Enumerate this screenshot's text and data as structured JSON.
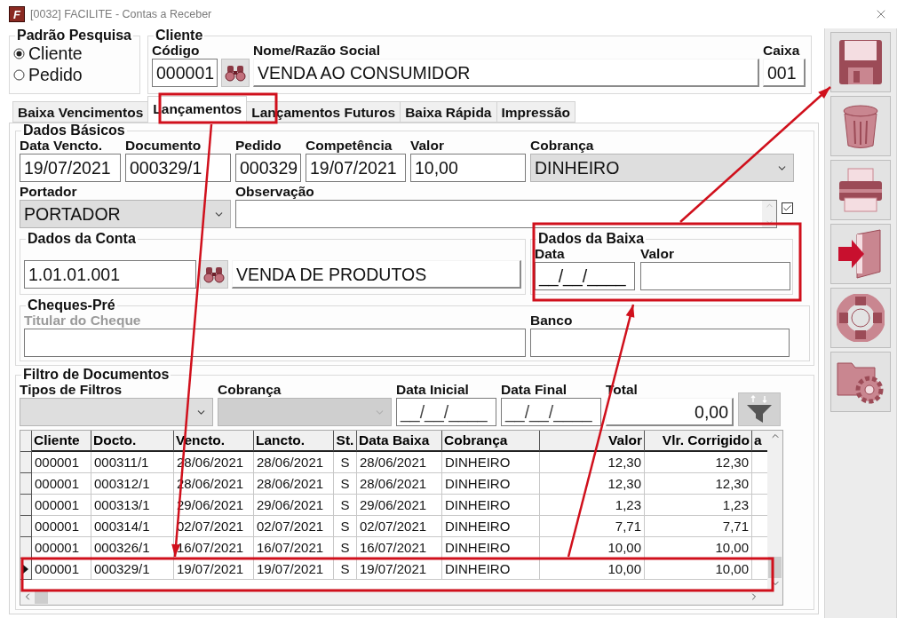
{
  "window": {
    "icon_text": "F",
    "title": "[0032] FACILITE - Contas a Receber"
  },
  "padrao_pesquisa": {
    "title": "Padrão Pesquisa",
    "options": [
      {
        "label": "Cliente",
        "selected": true
      },
      {
        "label": "Pedido",
        "selected": false
      }
    ]
  },
  "cliente": {
    "title": "Cliente",
    "codigo": {
      "label": "Código",
      "value": "000001"
    },
    "nome": {
      "label": "Nome/Razão Social",
      "value": "VENDA AO CONSUMIDOR"
    },
    "caixa": {
      "label": "Caixa",
      "value": "001"
    }
  },
  "tabs": [
    {
      "label": "Baixa Vencimentos",
      "selected": false
    },
    {
      "label": "Lançamentos",
      "selected": true
    },
    {
      "label": "Lançamentos Futuros",
      "selected": false
    },
    {
      "label": "Baixa Rápida",
      "selected": false
    },
    {
      "label": "Impressão",
      "selected": false
    }
  ],
  "dados_basicos": {
    "title": "Dados Básicos",
    "fields": [
      {
        "kind": "text",
        "label": "Data Vencto.",
        "value": "19/07/2021"
      },
      {
        "kind": "text",
        "label": "Documento",
        "value": "000329/1"
      },
      {
        "kind": "text",
        "label": "Pedido",
        "value": "000329"
      },
      {
        "kind": "text",
        "label": "Competência",
        "value": "19/07/2021"
      },
      {
        "kind": "text",
        "label": "Valor",
        "value": "10,00"
      },
      {
        "kind": "select",
        "label": "Cobrança",
        "value": "DINHEIRO"
      }
    ],
    "portador": {
      "label": "Portador",
      "value": "PORTADOR"
    },
    "observacao": {
      "label": "Observação",
      "checked": true
    }
  },
  "dados_da_conta": {
    "title": "Dados da Conta",
    "code": "1.01.01.001",
    "name": "VENDA DE PRODUTOS"
  },
  "dados_da_baixa": {
    "title": "Dados da Baixa",
    "data": {
      "label": "Data",
      "value": "__/__/____"
    },
    "valor": {
      "label": "Valor"
    }
  },
  "cheques_pre": {
    "title": "Cheques-Pré",
    "titular": {
      "label": "Titular do Cheque",
      "disabled": true
    },
    "banco": {
      "label": "Banco"
    }
  },
  "filtro": {
    "title": "Filtro de Documentos",
    "fields": [
      {
        "kind": "select",
        "label": "Tipos de Filtros",
        "disabled": false
      },
      {
        "kind": "select",
        "label": "Cobrança",
        "disabled": true
      },
      {
        "kind": "date",
        "label": "Data Inicial",
        "value": "__/__/____"
      },
      {
        "kind": "date",
        "label": "Data Final",
        "value": "__/__/____"
      },
      {
        "kind": "total",
        "label": "Total",
        "value": "0,00"
      }
    ]
  },
  "grid": {
    "columns": [
      {
        "label": "Cliente",
        "kind": "text"
      },
      {
        "label": "Docto.",
        "kind": "text"
      },
      {
        "label": "Vencto.",
        "kind": "text"
      },
      {
        "label": "Lancto.",
        "kind": "text"
      },
      {
        "label": "St.",
        "kind": "flag"
      },
      {
        "label": "Data Baixa",
        "kind": "text"
      },
      {
        "label": "Cobrança",
        "kind": "text"
      },
      {
        "label": "Valor",
        "kind": "number"
      },
      {
        "label": "Vlr. Corrigido",
        "kind": "number"
      },
      {
        "label": "a",
        "kind": "text"
      }
    ],
    "rows": [
      {
        "selected": false,
        "cells": [
          "000001",
          "000311/1",
          "28/06/2021",
          "28/06/2021",
          "S",
          "28/06/2021",
          "DINHEIRO",
          "12,30",
          "12,30"
        ]
      },
      {
        "selected": false,
        "cells": [
          "000001",
          "000312/1",
          "28/06/2021",
          "28/06/2021",
          "S",
          "28/06/2021",
          "DINHEIRO",
          "12,30",
          "12,30"
        ]
      },
      {
        "selected": false,
        "cells": [
          "000001",
          "000313/1",
          "29/06/2021",
          "29/06/2021",
          "S",
          "29/06/2021",
          "DINHEIRO",
          "1,23",
          "1,23"
        ]
      },
      {
        "selected": false,
        "cells": [
          "000001",
          "000314/1",
          "02/07/2021",
          "02/07/2021",
          "S",
          "02/07/2021",
          "DINHEIRO",
          "7,71",
          "7,71"
        ]
      },
      {
        "selected": false,
        "cells": [
          "000001",
          "000326/1",
          "16/07/2021",
          "16/07/2021",
          "S",
          "16/07/2021",
          "DINHEIRO",
          "10,00",
          "10,00"
        ]
      },
      {
        "selected": true,
        "cells": [
          "000001",
          "000329/1",
          "19/07/2021",
          "19/07/2021",
          "S",
          "19/07/2021",
          "DINHEIRO",
          "10,00",
          "10,00"
        ]
      }
    ]
  },
  "toolbar": [
    {
      "kind": "save"
    },
    {
      "kind": "delete"
    },
    {
      "kind": "print"
    },
    {
      "kind": "exit"
    },
    {
      "kind": "help"
    },
    {
      "kind": "settings"
    }
  ]
}
